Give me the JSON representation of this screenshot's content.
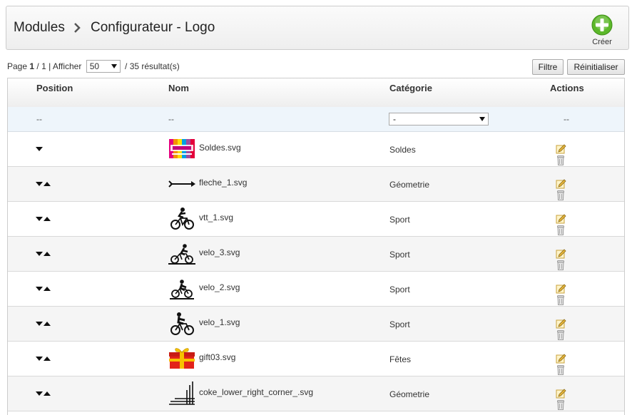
{
  "breadcrumb": {
    "root": "Modules",
    "current": "Configurateur - Logo"
  },
  "toolbar": {
    "create_label": "Créer"
  },
  "pagination": {
    "page_prefix": "Page",
    "page_current": "1",
    "page_separator": "/ 1 | Afficher",
    "per_page": "50",
    "results": "/ 35 résultat(s)"
  },
  "buttons": {
    "filter": "Filtre",
    "reset": "Réinitialiser"
  },
  "table": {
    "headers": {
      "position": "Position",
      "name": "Nom",
      "category": "Catégorie",
      "actions": "Actions"
    },
    "filter": {
      "position": "--",
      "name": "--",
      "category": "-",
      "actions": "--"
    },
    "rows": [
      {
        "file": "Soldes.svg",
        "category": "Soldes",
        "thumb": "soldes-thumbnail",
        "up": false
      },
      {
        "file": "fleche_1.svg",
        "category": "Géometrie",
        "thumb": "arrow-thumbnail",
        "up": true
      },
      {
        "file": "vtt_1.svg",
        "category": "Sport",
        "thumb": "mountain-bike-thumbnail",
        "up": true
      },
      {
        "file": "velo_3.svg",
        "category": "Sport",
        "thumb": "cyclist-thumbnail",
        "up": true
      },
      {
        "file": "velo_2.svg",
        "category": "Sport",
        "thumb": "cyclist-thumbnail",
        "up": true
      },
      {
        "file": "velo_1.svg",
        "category": "Sport",
        "thumb": "cyclist-thumbnail",
        "up": true
      },
      {
        "file": "gift03.svg",
        "category": "Fêtes",
        "thumb": "gift-thumbnail",
        "up": true
      },
      {
        "file": "coke_lower_right_corner_.svg",
        "category": "Géometrie",
        "thumb": "corner-thumbnail",
        "up": true
      }
    ]
  },
  "colors": {
    "create_green": "#5cb82a",
    "edit_yellow": "#e8b73a",
    "filter_row": "#eef5fb"
  }
}
